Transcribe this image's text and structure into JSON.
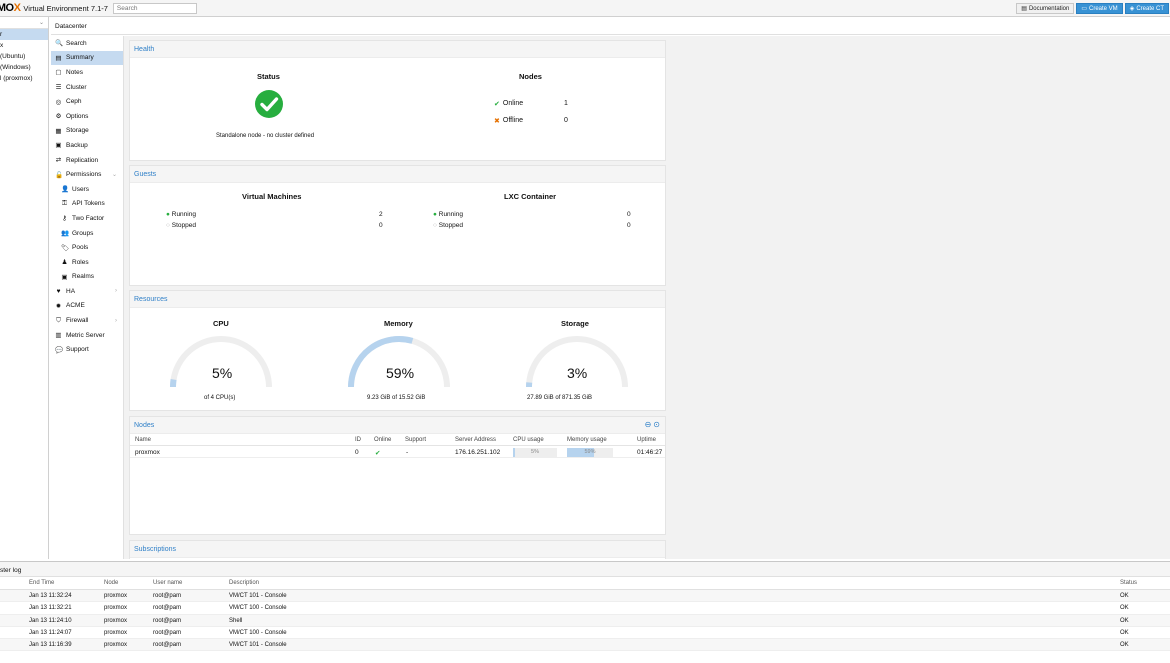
{
  "topbar": {
    "logo_prefix": "X",
    "logo_mo": "MO",
    "logo_x": "X",
    "title": "Virtual Environment 7.1-7",
    "search_placeholder": "Search",
    "documentation": "Documentation",
    "create_vm": "Create VM",
    "create_ct": "Create CT"
  },
  "tree": {
    "items": [
      "r",
      "x",
      "(Ubuntu)",
      "(Windows)",
      "l (proxmox)"
    ]
  },
  "breadcrumb": "Datacenter",
  "nav": [
    {
      "label": "Search",
      "icon": "search-icon",
      "glyph": "🔍",
      "sub": false
    },
    {
      "label": "Summary",
      "icon": "book-icon",
      "glyph": "▤",
      "sub": false,
      "selected": true
    },
    {
      "label": "Notes",
      "icon": "note-icon",
      "glyph": "▢",
      "sub": false
    },
    {
      "label": "Cluster",
      "icon": "server-icon",
      "glyph": "☰",
      "sub": false
    },
    {
      "label": "Ceph",
      "icon": "ceph-icon",
      "glyph": "◎",
      "sub": false
    },
    {
      "label": "Options",
      "icon": "gear-icon",
      "glyph": "⚙",
      "sub": false
    },
    {
      "label": "Storage",
      "icon": "database-icon",
      "glyph": "▦",
      "sub": false
    },
    {
      "label": "Backup",
      "icon": "floppy-icon",
      "glyph": "▣",
      "sub": false
    },
    {
      "label": "Replication",
      "icon": "retweet-icon",
      "glyph": "⇄",
      "sub": false
    },
    {
      "label": "Permissions",
      "icon": "unlock-icon",
      "glyph": "🔓",
      "sub": false,
      "arrow": "⌄"
    },
    {
      "label": "Users",
      "icon": "user-icon",
      "glyph": "👤",
      "sub": true
    },
    {
      "label": "API Tokens",
      "icon": "key-icon",
      "glyph": "⚿",
      "sub": true
    },
    {
      "label": "Two Factor",
      "icon": "key-icon",
      "glyph": "⚷",
      "sub": true
    },
    {
      "label": "Groups",
      "icon": "users-icon",
      "glyph": "👥",
      "sub": true
    },
    {
      "label": "Pools",
      "icon": "tags-icon",
      "glyph": "🏷",
      "sub": true
    },
    {
      "label": "Roles",
      "icon": "male-icon",
      "glyph": "♟",
      "sub": true
    },
    {
      "label": "Realms",
      "icon": "address-book-icon",
      "glyph": "▣",
      "sub": true
    },
    {
      "label": "HA",
      "icon": "heartbeat-icon",
      "glyph": "♥",
      "sub": false,
      "arrow": "›"
    },
    {
      "label": "ACME",
      "icon": "certificate-icon",
      "glyph": "✹",
      "sub": false
    },
    {
      "label": "Firewall",
      "icon": "shield-icon",
      "glyph": "⛉",
      "sub": false,
      "arrow": "›"
    },
    {
      "label": "Metric Server",
      "icon": "bar-chart-icon",
      "glyph": "▥",
      "sub": false
    },
    {
      "label": "Support",
      "icon": "comments-icon",
      "glyph": "💬",
      "sub": false
    }
  ],
  "health": {
    "title": "Health",
    "status_title": "Status",
    "status_text": "Standalone node - no cluster defined",
    "nodes_title": "Nodes",
    "online_label": "Online",
    "online_count": "1",
    "offline_label": "Offline",
    "offline_count": "0"
  },
  "guests": {
    "title": "Guests",
    "vm_title": "Virtual Machines",
    "vm_running_label": "Running",
    "vm_running": "2",
    "vm_stopped_label": "Stopped",
    "vm_stopped": "0",
    "lxc_title": "LXC Container",
    "lxc_running_label": "Running",
    "lxc_running": "0",
    "lxc_stopped_label": "Stopped",
    "lxc_stopped": "0"
  },
  "resources": {
    "title": "Resources",
    "cpu_title": "CPU",
    "cpu_pct": "5%",
    "cpu_frac": 0.05,
    "cpu_sub": "of 4 CPU(s)",
    "mem_title": "Memory",
    "mem_pct": "59%",
    "mem_frac": 0.59,
    "mem_sub": "9.23 GiB of 15.52 GiB",
    "sto_title": "Storage",
    "sto_pct": "3%",
    "sto_frac": 0.03,
    "sto_sub": "27.89 GiB of 871.35 GiB"
  },
  "nodes_grid": {
    "title": "Nodes",
    "columns": {
      "name": "Name",
      "id": "ID",
      "online": "Online",
      "support": "Support",
      "address": "Server Address",
      "cpu": "CPU usage",
      "mem": "Memory usage",
      "uptime": "Uptime"
    },
    "row": {
      "name": "proxmox",
      "id": "0",
      "online": "✔",
      "support": "-",
      "address": "176.16.251.102",
      "cpu": "5%",
      "cpu_frac": 0.05,
      "mem": "59%",
      "mem_frac": 0.59,
      "uptime": "01:46:27"
    }
  },
  "subscriptions": {
    "title": "Subscriptions"
  },
  "tasklog": {
    "title": "ster log",
    "columns": {
      "end": "End Time",
      "node": "Node",
      "user": "User name",
      "desc": "Description",
      "status": "Status"
    },
    "rows": [
      {
        "end": "Jan 13 11:32:24",
        "node": "proxmox",
        "user": "root@pam",
        "desc": "VM/CT 101 - Console",
        "status": "OK"
      },
      {
        "end": "Jan 13 11:32:21",
        "node": "proxmox",
        "user": "root@pam",
        "desc": "VM/CT 100 - Console",
        "status": "OK"
      },
      {
        "end": "Jan 13 11:24:10",
        "node": "proxmox",
        "user": "root@pam",
        "desc": "Shell",
        "status": "OK"
      },
      {
        "end": "Jan 13 11:24:07",
        "node": "proxmox",
        "user": "root@pam",
        "desc": "VM/CT 100 - Console",
        "status": "OK"
      },
      {
        "end": "Jan 13 11:16:39",
        "node": "proxmox",
        "user": "root@pam",
        "desc": "VM/CT 101 - Console",
        "status": "OK"
      }
    ]
  },
  "colors": {
    "accent": "#3892d4",
    "ok_green": "#27ae3f",
    "offline_orange": "#e57000",
    "gauge_track": "#eeeeee",
    "gauge_fill": "#b6d3ee"
  }
}
